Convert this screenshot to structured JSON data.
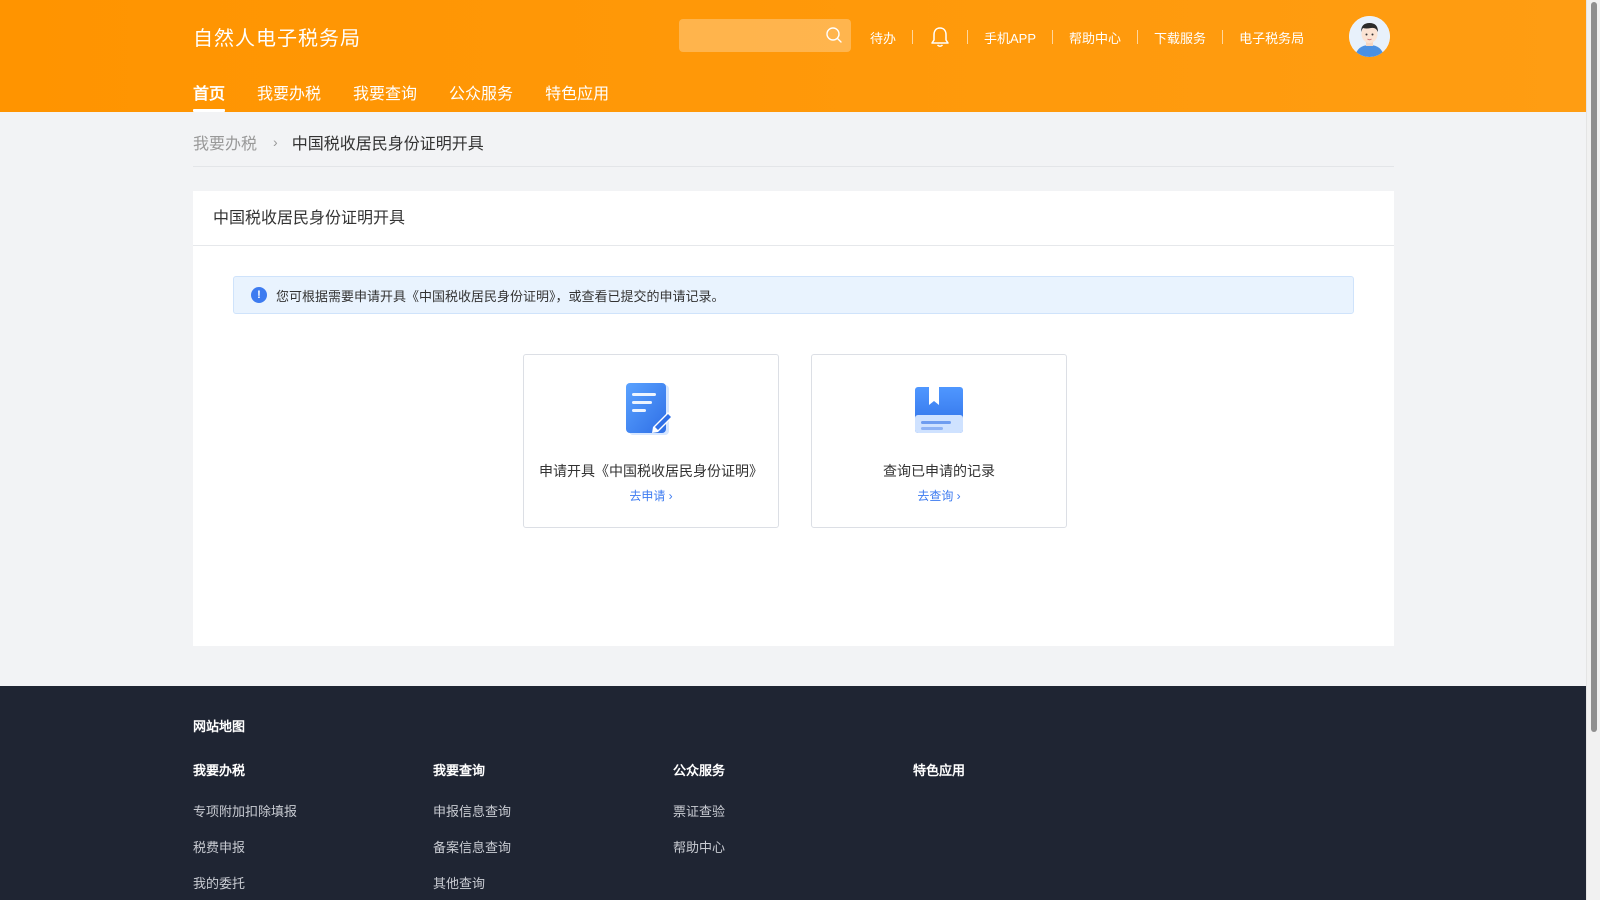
{
  "header": {
    "brand": "自然人电子税务局",
    "search": {
      "placeholder": ""
    },
    "links": [
      "待办",
      "手机APP",
      "帮助中心",
      "下载服务",
      "电子税务局"
    ]
  },
  "nav": {
    "items": [
      {
        "label": "首页",
        "active": true
      },
      {
        "label": "我要办税",
        "active": false
      },
      {
        "label": "我要查询",
        "active": false
      },
      {
        "label": "公众服务",
        "active": false
      },
      {
        "label": "特色应用",
        "active": false
      }
    ]
  },
  "breadcrumb": {
    "parent": "我要办税",
    "current": "中国税收居民身份证明开具"
  },
  "panel": {
    "title": "中国税收居民身份证明开具",
    "notice": "您可根据需要申请开具《中国税收居民身份证明》，或查看已提交的申请记录。",
    "cards": [
      {
        "icon": "edit-document-icon",
        "title": "申请开具《中国税收居民身份证明》",
        "link": "去申请"
      },
      {
        "icon": "book-record-icon",
        "title": "查询已申请的记录",
        "link": "去查询"
      }
    ]
  },
  "footer": {
    "sitemap": "网站地图",
    "columns": [
      {
        "head": "我要办税",
        "items": [
          "专项附加扣除填报",
          "税费申报",
          "我的委托"
        ]
      },
      {
        "head": "我要查询",
        "items": [
          "申报信息查询",
          "备案信息查询",
          "其他查询"
        ]
      },
      {
        "head": "公众服务",
        "items": [
          "票证查验",
          "帮助中心"
        ]
      },
      {
        "head": "特色应用",
        "items": []
      }
    ]
  },
  "colors": {
    "header_orange": "#ff9400",
    "link_blue": "#3d7bf0",
    "footer_bg": "#1f2533"
  }
}
